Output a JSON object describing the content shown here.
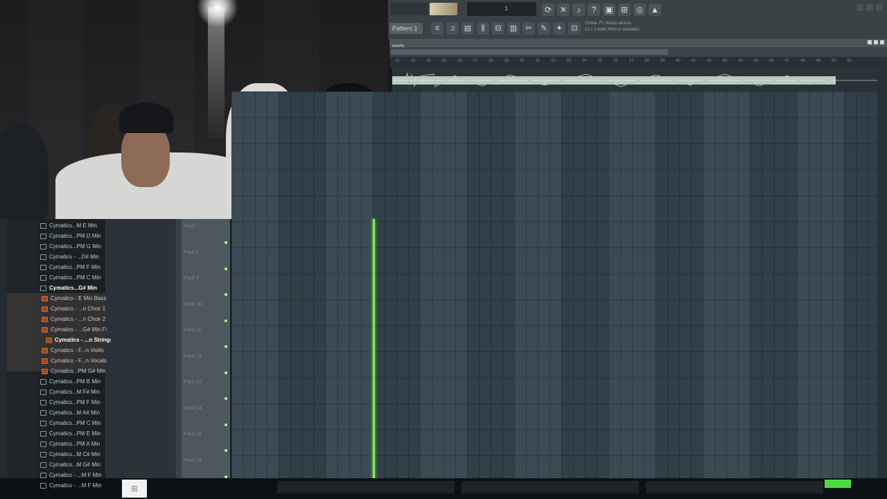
{
  "toolbar": {
    "pattern_label": "Pattern 1",
    "time_display": "1",
    "news_line1": "Online: FL Studio version",
    "news_line2": "21.2.3 build 4004 is available!",
    "icons": [
      "metronome-icon",
      "record-icon",
      "mic-icon",
      "help-icon",
      "save-icon",
      "mixer-icon",
      "chat-icon",
      "export-icon"
    ],
    "tools": [
      "playlist-icon",
      "piano-roll-icon",
      "channel-rack-icon",
      "mixer-icon",
      "plugin-picker-icon",
      "browser-icon",
      "cut-icon",
      "paint-icon",
      "mute-icon",
      "slip-icon"
    ]
  },
  "playlist": {
    "title": "ports",
    "ruler": [
      "22",
      "23",
      "24",
      "25",
      "26",
      "27",
      "28",
      "29",
      "30",
      "31",
      "32",
      "33",
      "34",
      "35",
      "36",
      "37",
      "38",
      "39",
      "40",
      "41",
      "42",
      "43",
      "44",
      "45",
      "46",
      "47",
      "48",
      "49",
      "50",
      "51"
    ],
    "tracks": [
      "Track 7",
      "Track 8",
      "Track 9",
      "Track 10",
      "Track 11",
      "Track 12",
      "Track 13",
      "Track 14",
      "Track 15",
      "Track 16"
    ]
  },
  "browser": {
    "items": [
      {
        "label": "Cymatics...M E Min",
        "kind": "folder"
      },
      {
        "label": "Cymatics...PM D Min",
        "kind": "folder"
      },
      {
        "label": "Cymatics...PM G Min",
        "kind": "folder"
      },
      {
        "label": "Cymatics - ...D# Min",
        "kind": "folder"
      },
      {
        "label": "Cymatics...PM F Min",
        "kind": "folder"
      },
      {
        "label": "Cymatics...PM C Min",
        "kind": "folder"
      },
      {
        "label": "Cymatics...G# Min",
        "kind": "folder-selected"
      },
      {
        "label": "Cymatics - E Min Bass",
        "kind": "sub"
      },
      {
        "label": "Cymatics - ...n Choir 1",
        "kind": "sub"
      },
      {
        "label": "Cymatics - ...n Choir 2",
        "kind": "sub"
      },
      {
        "label": "Cymatics - ...G# Min Fx",
        "kind": "sub"
      },
      {
        "label": "Cymatics - ...n Strings",
        "kind": "sub-selected"
      },
      {
        "label": "Cymatics - F...n Violin",
        "kind": "sub"
      },
      {
        "label": "Cymatics - F...n Vocals",
        "kind": "sub"
      },
      {
        "label": "Cymatics...PM G# Min",
        "kind": "sub"
      },
      {
        "label": "Cymatics...PM B Min",
        "kind": "folder"
      },
      {
        "label": "Cymatics...M F# Min",
        "kind": "folder"
      },
      {
        "label": "Cymatics...PM F Min",
        "kind": "folder"
      },
      {
        "label": "Cymatics...M A# Min",
        "kind": "folder"
      },
      {
        "label": "Cymatics...PM C Min",
        "kind": "folder"
      },
      {
        "label": "Cymatics...PM E Min",
        "kind": "folder"
      },
      {
        "label": "Cymatics...PM A Min",
        "kind": "folder"
      },
      {
        "label": "Cymatics...M C# Min",
        "kind": "folder"
      },
      {
        "label": "Cymatics...M G# Min",
        "kind": "folder"
      },
      {
        "label": "Cymatics - ...M F Min",
        "kind": "folder"
      },
      {
        "label": "Cymatics - ...M F Min",
        "kind": "folder"
      }
    ]
  },
  "colors": {
    "accent_green": "#7ef04a",
    "grid": "#34434d",
    "toolbar": "#3a4246"
  }
}
